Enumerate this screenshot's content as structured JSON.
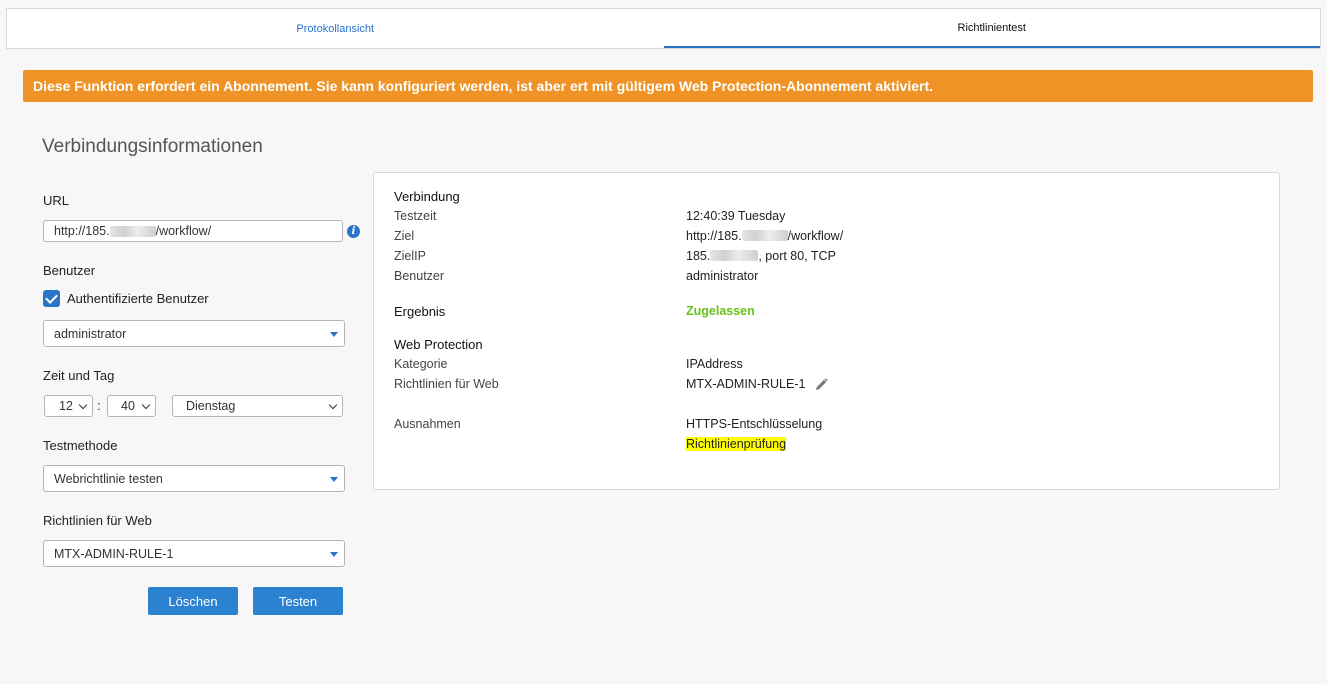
{
  "tabs": [
    {
      "label": "Protokollansicht",
      "active": false
    },
    {
      "label": "Richtlinientest",
      "active": true
    }
  ],
  "banner": {
    "text": "Diese Funktion erfordert ein Abonnement. Sie kann konfiguriert werden, ist aber ert mit gültigem Web Protection-Abonnement aktiviert.",
    "color": "#ef9327"
  },
  "form": {
    "title": "Verbindungsinformationen",
    "url_label": "URL",
    "url_prefix": "http://185.",
    "url_suffix": "/workflow/",
    "user_label": "Benutzer",
    "auth_checkbox_label": "Authentifizierte Benutzer",
    "auth_checked": true,
    "user_select": "administrator",
    "time_label": "Zeit und Tag",
    "hour": "12",
    "time_sep": ":",
    "minute": "40",
    "day": "Dienstag",
    "method_label": "Testmethode",
    "method_select": "Webrichtlinie testen",
    "policy_label": "Richtlinien für Web",
    "policy_select": "MTX-ADMIN-RULE-1",
    "clear_button": "Löschen",
    "test_button": "Testen"
  },
  "result": {
    "connection_heading": "Verbindung",
    "test_time_key": "Testzeit",
    "test_time_val": "12:40:39 Tuesday",
    "target_key": "Ziel",
    "target_prefix": "http://185.",
    "target_suffix": "/workflow/",
    "target_ip_key": "ZielIP",
    "target_ip_prefix": "185.",
    "target_ip_suffix": ", port 80, TCP",
    "user_key": "Benutzer",
    "user_val": "administrator",
    "result_key": "Ergebnis",
    "result_val": "Zugelassen",
    "wp_heading": "Web Protection",
    "category_key": "Kategorie",
    "category_val": "IPAddress",
    "policy_key": "Richtlinien für Web",
    "policy_val": "MTX-ADMIN-RULE-1",
    "exceptions_key": "Ausnahmen",
    "exception_1": "HTTPS-Entschlüsselung",
    "exception_2": "Richtlinienprüfung"
  },
  "colors": {
    "accent": "#2a74c8",
    "allowed": "#66c21a",
    "highlight": "#ffff00"
  }
}
